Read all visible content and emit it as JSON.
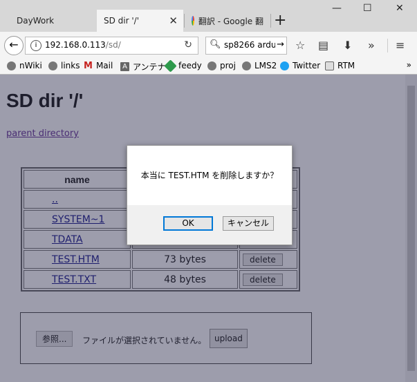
{
  "browser": {
    "tabs": [
      {
        "label": "DayWork"
      },
      {
        "label": "SD dir '/'",
        "close": "✕"
      },
      {
        "label": "翻訳 - Google 翻"
      }
    ],
    "new_tab": "+",
    "url_host": "192.168.0.113",
    "url_path": "/sd/",
    "search_text": "sp8266 ardu",
    "bookmarks": [
      {
        "label": "nWiki"
      },
      {
        "label": "links"
      },
      {
        "label": "Mail"
      },
      {
        "label": "アンテナ"
      },
      {
        "label": "feedy"
      },
      {
        "label": "proj"
      },
      {
        "label": "LMS2"
      },
      {
        "label": "Twitter"
      },
      {
        "label": "RTM"
      }
    ],
    "bookmarks_more": "»"
  },
  "page": {
    "title": "SD dir '/'",
    "parent_link": "parent directory",
    "table_header": "name",
    "files": [
      {
        "name": ".."
      },
      {
        "name": "SYSTEM~1"
      },
      {
        "name": "TDATA"
      },
      {
        "name": "TEST.HTM",
        "size": "73 bytes",
        "action": "delete"
      },
      {
        "name": "TEST.TXT",
        "size": "48 bytes",
        "action": "delete"
      }
    ],
    "browse_label": "参照...",
    "no_file": "ファイルが選択されていません。",
    "upload_label": "upload"
  },
  "dialog": {
    "message": "本当に TEST.HTM を削除しますか？",
    "ok": "OK",
    "cancel": "キャンセル"
  }
}
